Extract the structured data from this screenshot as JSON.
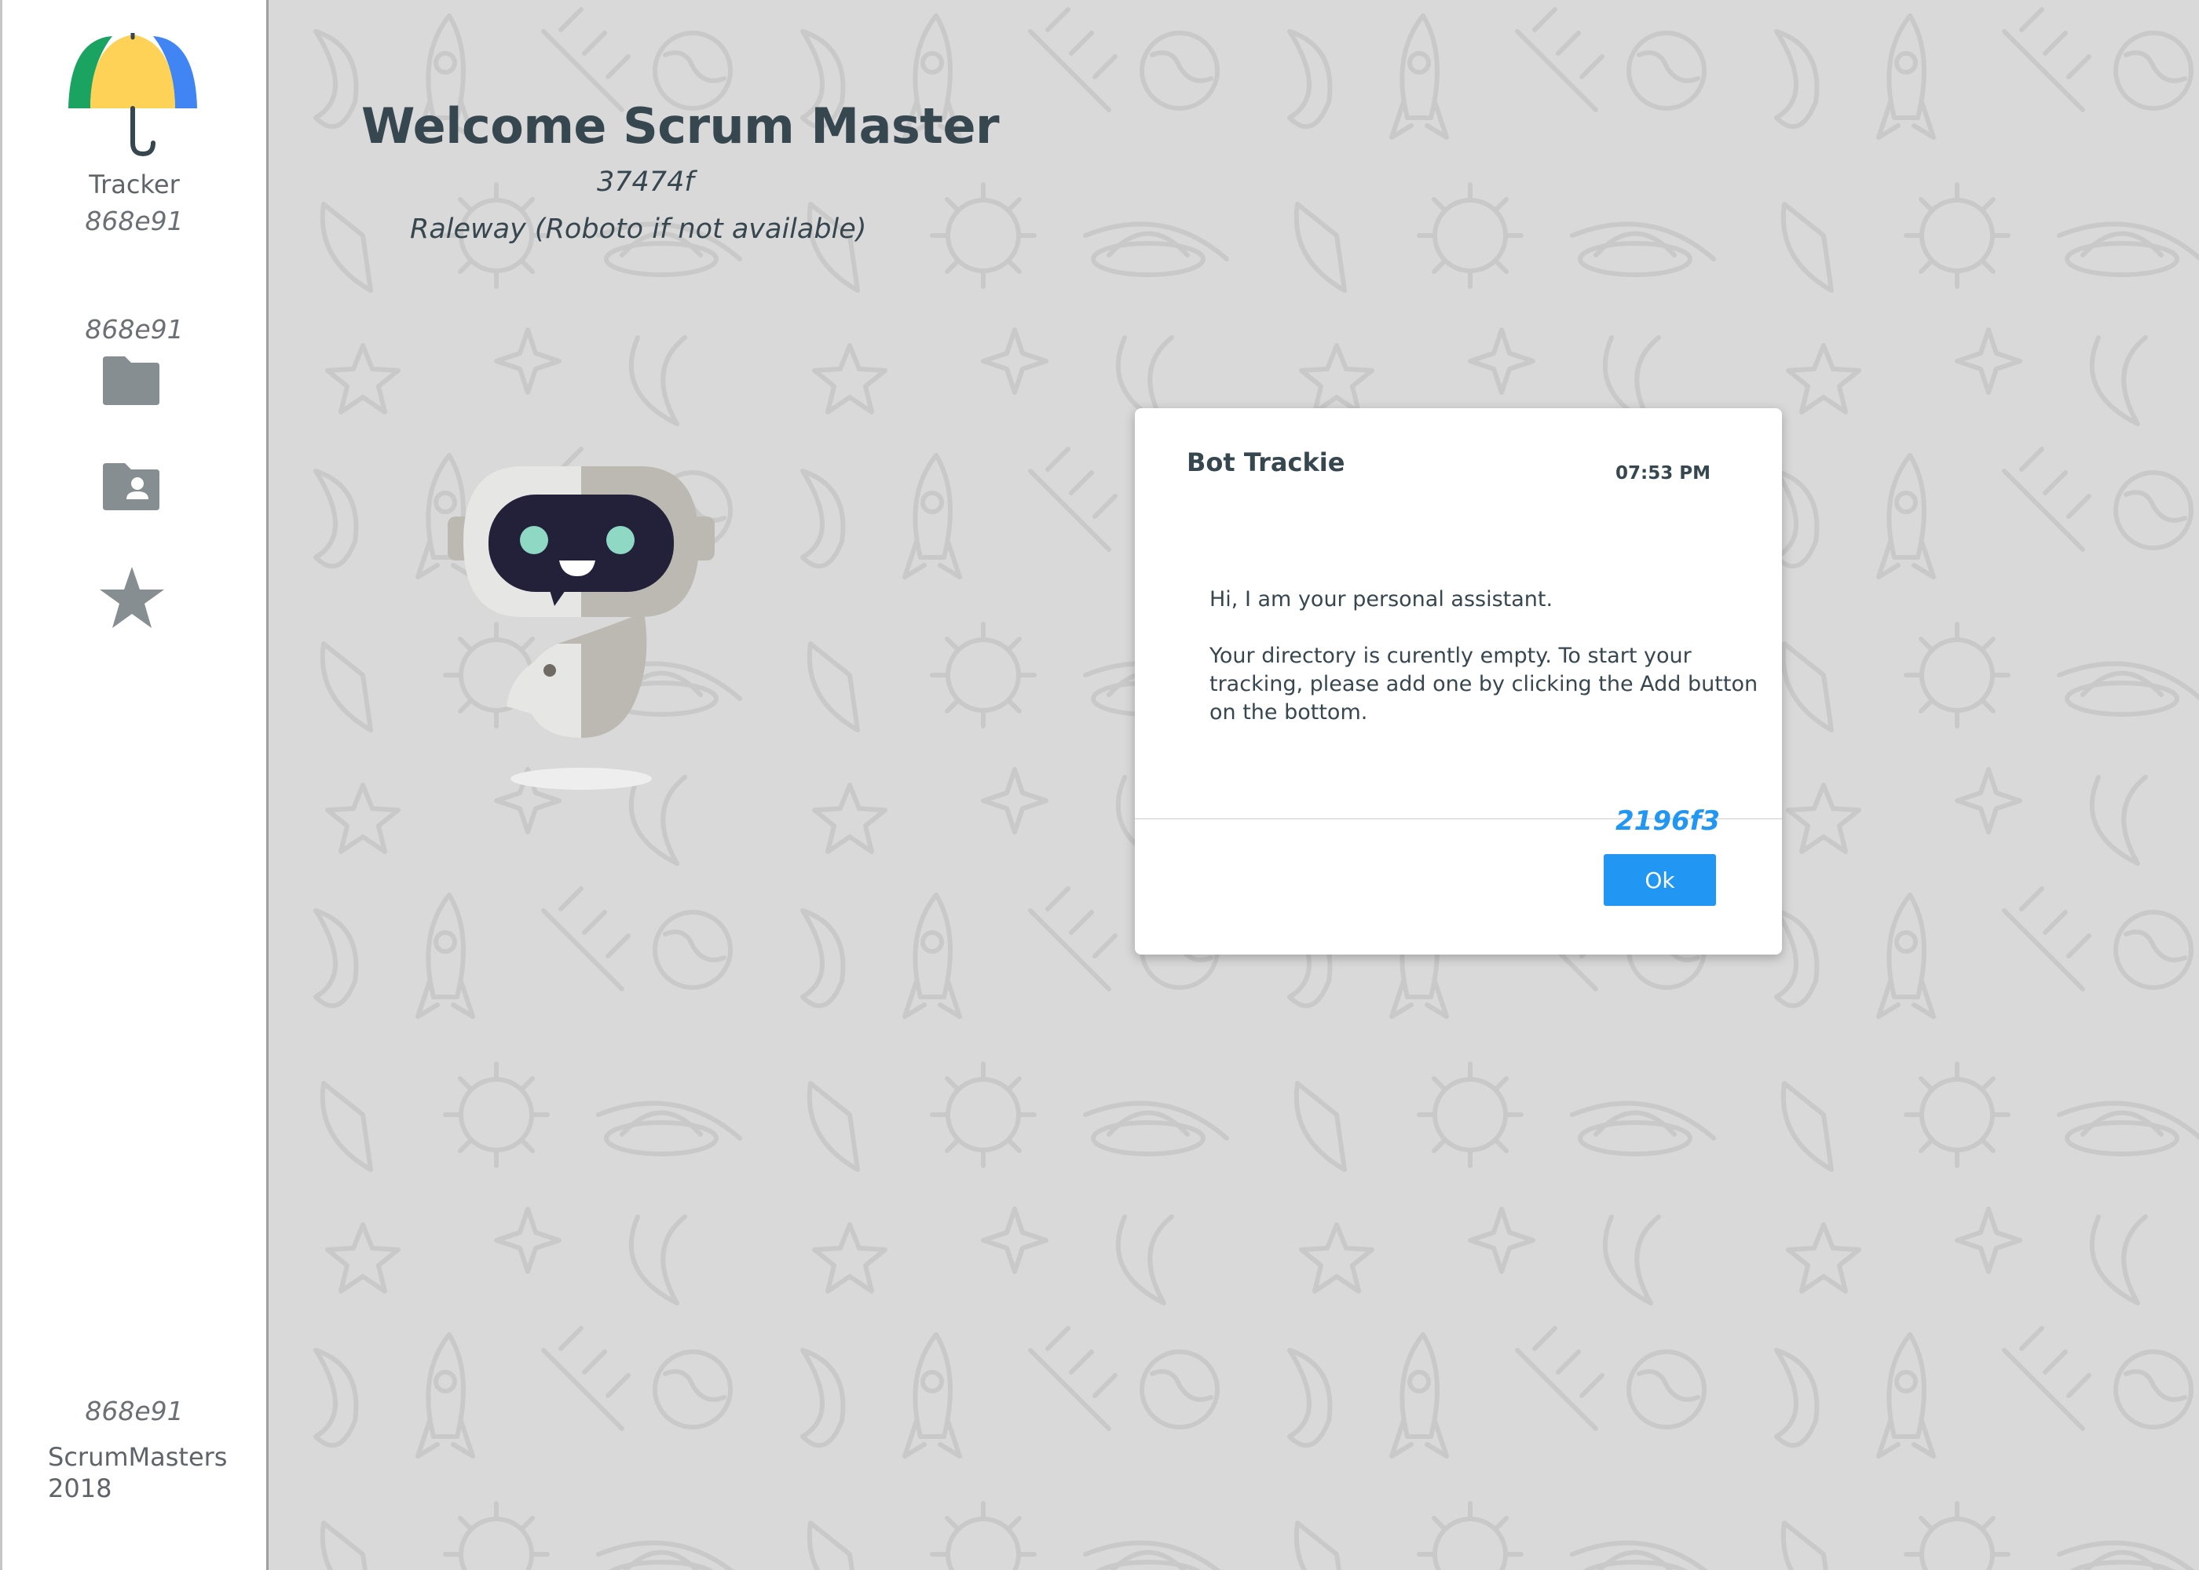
{
  "sidebar": {
    "app_name": "Tracker",
    "color_note_top": "868e91",
    "color_note_nav": "868e91",
    "color_note_footer": "868e91",
    "footer_brand": "ScrumMasters",
    "footer_year": "2018",
    "nav": [
      {
        "icon": "folder-icon"
      },
      {
        "icon": "contact-folder-icon"
      },
      {
        "icon": "star-icon"
      }
    ]
  },
  "header": {
    "title": "Welcome Scrum Master",
    "color_note": "37474f",
    "font_note": "Raleway (Roboto if not available)"
  },
  "dialog": {
    "sender": "Bot Trackie",
    "time": "07:53 PM",
    "message_lines": [
      "Hi, I am your personal assistant.",
      "Your directory is curently empty. To start your tracking, please add one by clicking the Add button on the bottom."
    ],
    "color_note": "2196f3",
    "ok_label": "Ok"
  },
  "colors": {
    "text": "#37474f",
    "icon_grey": "#868e91",
    "accent": "#2196f3",
    "background": "#d9d9d9",
    "umbrella_green": "#1ba362",
    "umbrella_yellow": "#fdd256",
    "umbrella_blue": "#4184f3"
  }
}
